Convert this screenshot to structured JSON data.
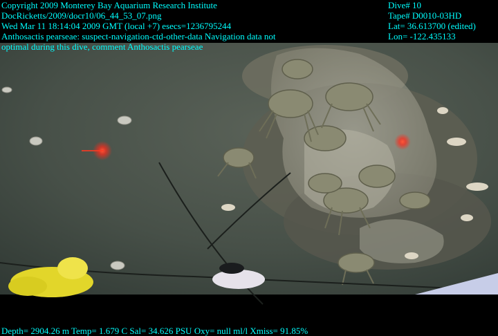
{
  "overlay": {
    "left_lines": [
      "Copyright 2009 Monterey Bay Aquarium Research Institute",
      "DocRicketts/2009/docr10/06_44_53_07.png",
      "Wed Mar 11 18:14:04 2009 GMT (local +7)  esecs=1236795244",
      "Anthosactis pearseae: suspect-navigation-ctd-other-data Navigation data not",
      "optimal during this dive, comment Anthosactis pearseae"
    ],
    "right_lines": [
      "Dive# 10",
      "Tape# D0010-03HD",
      "Lat= 36.613700 (edited)",
      "Lon= -122.435133"
    ],
    "bottom_line": "Depth= 2904.26 m  Temp= 1.679 C  Sal= 34.626 PSU  Oxy= null ml/l  Xmiss= 91.85%",
    "text_color": "#00ffff"
  },
  "scene": {
    "seafloor_color": "#4a524a",
    "crab_color": "#8a8a72",
    "laser_color": "#ff2a1a",
    "letterbox_color": "#000000"
  }
}
